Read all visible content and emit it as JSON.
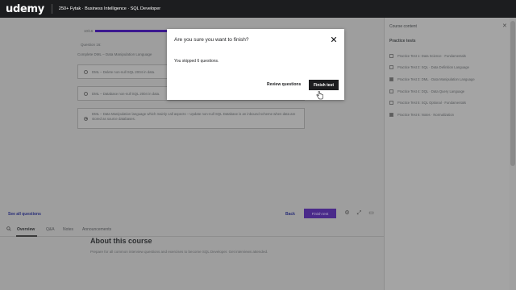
{
  "topbar": {
    "logo": "udemy",
    "course_title": "250+ Fytak · Business Intelligence · SQL Developer"
  },
  "main": {
    "progress_label": "10/16",
    "progress_fraction": 0.55,
    "question_label": "Question 16:",
    "question_text": "Complete DML – Data Manipulation Language",
    "options": [
      {
        "text": "DML – Delete non-null SQL 2004 in data.",
        "checked": false
      },
      {
        "text": "DML – Database non-null SQL 2004 in data.",
        "checked": false
      },
      {
        "text": "DML – Data Manipulation language which mainly call aspects – Update non-null SQL Database is an inbound scheme when data are stored as source databases.",
        "checked": true
      }
    ],
    "see_all_label": "See all questions",
    "back_label": "Back",
    "finish_dim_label": "Finish test",
    "tabs": [
      "Overview",
      "Q&A",
      "Notes",
      "Announcements"
    ],
    "about_title": "About this course",
    "about_text": "Prepare for all common interview questions and exercises to become SQL Developer. Get interviews attended."
  },
  "sidebar": {
    "title": "Course content",
    "section_title": "Practice tests",
    "items": [
      {
        "label": "Practice Test 1: Data Science · Fundamentals",
        "done": false
      },
      {
        "label": "Practice Test 2: SQL · Data Definition Language",
        "done": false
      },
      {
        "label": "Practice Test 3: DML · Data Manipulation Language",
        "done": true
      },
      {
        "label": "Practice Test 4: DQL · Data Query Language",
        "done": false
      },
      {
        "label": "Practice Test 5: SQL Optional · Fundamentals",
        "done": false
      },
      {
        "label": "Practice Test 6: Notes · Normalization",
        "done": true
      }
    ]
  },
  "modal": {
    "title": "Are you sure you want to finish?",
    "body": "You skipped 6 questions.",
    "review_label": "Review questions",
    "finish_label": "Finish test"
  },
  "colors": {
    "accent": "#3b198f",
    "topbar": "#1c1d1f",
    "overlay": "#9e9e9e"
  }
}
